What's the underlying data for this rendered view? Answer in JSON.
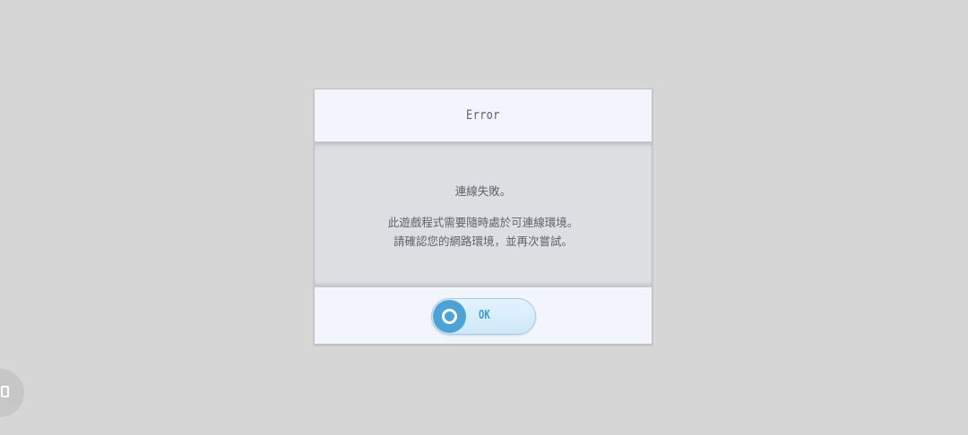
{
  "dialog": {
    "title": "Error",
    "message_line_1": "連線失敗。",
    "message_line_2": "此遊戲程式需要隨時處於可連線環境。",
    "message_line_3": "請確認您的網路環境，並再次嘗試。",
    "ok_label": "OK",
    "ok_icon": "circle-o-icon"
  },
  "overlay": {
    "floating_icon": "square-icon"
  }
}
